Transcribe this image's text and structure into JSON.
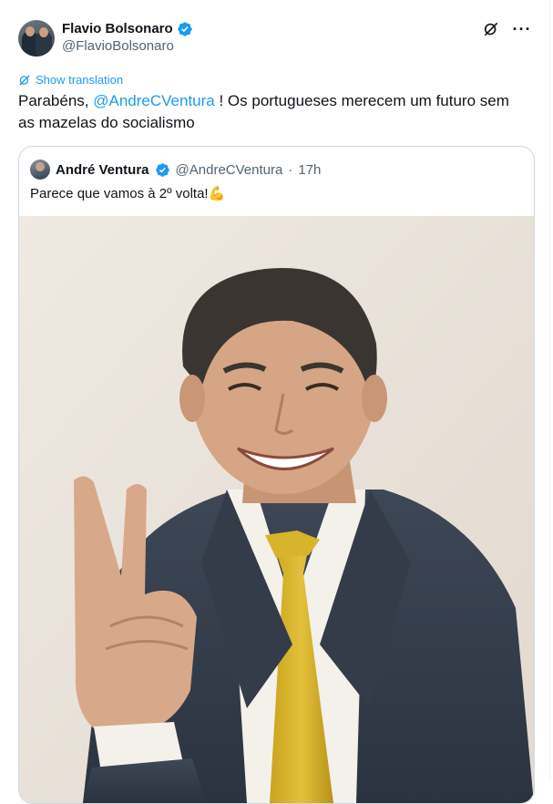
{
  "author": {
    "display_name": "Flavio Bolsonaro",
    "handle": "@FlavioBolsonaro"
  },
  "translate_label": "Show translation",
  "tweet": {
    "text_before": "Parabéns, ",
    "mention": "@AndreCVentura",
    "text_after": " ! Os portugueses merecem um futuro sem as mazelas do socialismo"
  },
  "quoted": {
    "display_name": "André Ventura",
    "handle": "@AndreCVentura",
    "separator": "·",
    "time": "17h",
    "text": "Parece que vamos à 2º volta!",
    "emoji": "💪"
  },
  "colors": {
    "accent": "#1d9bf0",
    "verified": "#1d9bf0",
    "text": "#0f1419",
    "muted": "#536471"
  },
  "icons": [
    "verified-badge-icon",
    "grok-icon",
    "more-icon",
    "translate-icon",
    "flexed-biceps-emoji"
  ]
}
